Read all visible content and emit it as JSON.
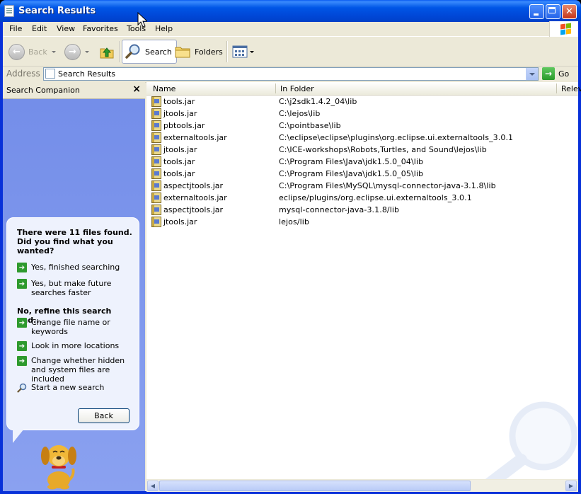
{
  "window": {
    "title": "Search Results"
  },
  "menubar": {
    "items": [
      "File",
      "Edit",
      "View",
      "Favorites",
      "Tools",
      "Help"
    ]
  },
  "toolbar": {
    "back_label": "Back",
    "search_label": "Search",
    "folders_label": "Folders"
  },
  "address": {
    "label": "Address",
    "value": "Search Results",
    "go_label": "Go"
  },
  "companion": {
    "title": "Search Companion",
    "heading": "There were 11 files found. Did you find what you wanted?",
    "options_yes": [
      "Yes, finished searching",
      "Yes, but make future searches faster"
    ],
    "refine_heading": "No, refine this search and...",
    "options_refine": [
      "Change file name or keywords",
      "Look in more locations",
      "Change whether hidden and system files are included"
    ],
    "new_search": "Start a new search",
    "back_button": "Back"
  },
  "results": {
    "columns": [
      "Name",
      "In Folder",
      "Relev"
    ],
    "rows": [
      {
        "name": "tools.jar",
        "folder": "C:\\j2sdk1.4.2_04\\lib"
      },
      {
        "name": "jtools.jar",
        "folder": "C:\\lejos\\lib"
      },
      {
        "name": "pbtools.jar",
        "folder": "C:\\pointbase\\lib"
      },
      {
        "name": "externaltools.jar",
        "folder": "C:\\eclipse\\eclipse\\plugins\\org.eclipse.ui.externaltools_3.0.1"
      },
      {
        "name": "jtools.jar",
        "folder": "C:\\ICE-workshops\\Robots,Turtles, and Sound\\lejos\\lib"
      },
      {
        "name": "tools.jar",
        "folder": "C:\\Program Files\\Java\\jdk1.5.0_04\\lib"
      },
      {
        "name": "tools.jar",
        "folder": "C:\\Program Files\\Java\\jdk1.5.0_05\\lib"
      },
      {
        "name": "aspectjtools.jar",
        "folder": "C:\\Program Files\\MySQL\\mysql-connector-java-3.1.8\\lib"
      },
      {
        "name": "externaltools.jar",
        "folder": "eclipse/plugins/org.eclipse.ui.externaltools_3.0.1"
      },
      {
        "name": "aspectjtools.jar",
        "folder": "mysql-connector-java-3.1.8/lib"
      },
      {
        "name": "jtools.jar",
        "folder": "lejos/lib"
      }
    ]
  },
  "icons": {
    "file_icon": "jar-file-icon",
    "search_icon": "magnifier-icon",
    "folders_icon": "folder-icon",
    "views_icon": "views-icon",
    "up_icon": "folder-up-icon",
    "go_icon": "green-arrow-icon"
  },
  "colors": {
    "titlebar": "#0054e3",
    "companion_bg": "#7a93ec",
    "arrow_green": "#2e9a2e",
    "panel_bg": "#ece9d8"
  }
}
